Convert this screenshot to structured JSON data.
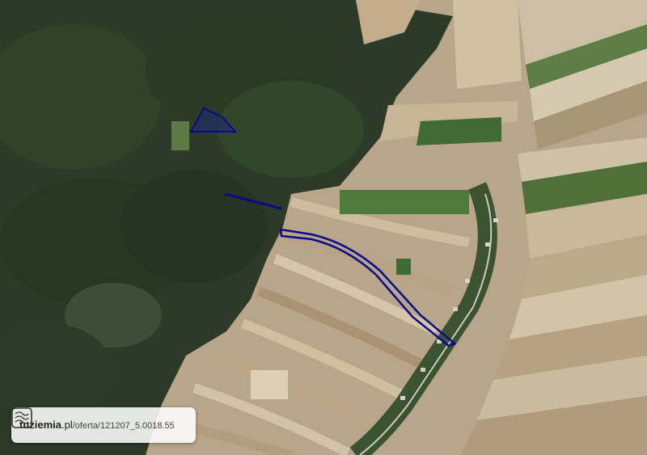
{
  "map": {
    "type": "satellite-parcel-view",
    "parcel_outline_color": "#0a0a8a"
  },
  "attribution": {
    "site": "tuziemia",
    "tld": ".pl",
    "path": "/oferta/121207_5.0018.55",
    "icon": "topographic-logo-icon"
  }
}
